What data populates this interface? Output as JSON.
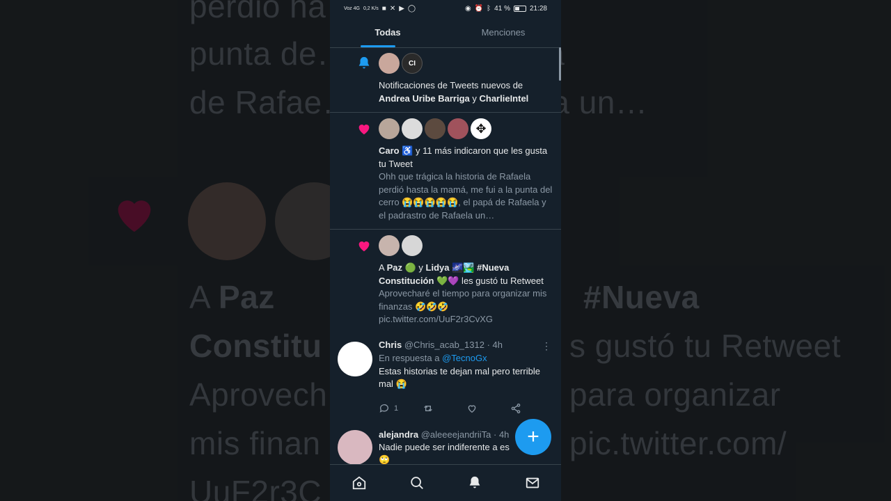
{
  "background": {
    "lines": [
      "perdió ha…                                me fui a la",
      "punta de…               😭😭, el papá",
      "de Rafae…               tro de Rafaela un…"
    ],
    "line_a": "A",
    "line_paz": "Paz",
    "line_nueva": "#Nueva",
    "line_constitu": "Constitu",
    "line_gusto": "s gustó tu Retweet",
    "line_aprovech": "Aprovech",
    "line_para": "para organizar",
    "line_mis": "mis finan",
    "line_pic": "pic.twitter.com/",
    "line_uuf": "UuF2r3C"
  },
  "status_bar": {
    "carrier": "Voz 4G",
    "speed": "0,2 K/s",
    "battery": "41 %",
    "time": "21:28"
  },
  "tabs": [
    {
      "label": "Todas",
      "active": true
    },
    {
      "label": "Menciones",
      "active": false
    }
  ],
  "notifications": [
    {
      "type": "bell",
      "text_pre": "Notificaciones de Tweets nuevos de",
      "bold_1": "Andrea Uribe Barriga",
      "mid": " y ",
      "bold_2": "CharlieIntel",
      "avatar_colors": [
        "#c9a79c",
        "#2a2a2a"
      ]
    },
    {
      "type": "like",
      "bold_1": "Caro",
      "emoji_1": "♿",
      "rest": " y 11 más indicaron que les gusta tu Tweet",
      "sub": "Ohh que trágica la historia de Rafaela perdió hasta la mamá, me fui a la punta del cerro 😭😭😭😭😭, el papá de Rafaela y el padrastro de Rafaela un…",
      "avatar_colors": [
        "#b8a69a",
        "#dcdcdc",
        "#5c4a3f",
        "#a0525c",
        "#ffffff"
      ]
    },
    {
      "type": "like",
      "text_a": "A ",
      "bold_1": "Paz",
      "emoji_1": "🟢",
      "mid": " y ",
      "bold_2": "Lidya",
      "emoji_2": "🌌🏞️",
      "bold_3": "#Nueva Constitución",
      "emoji_3": "💚💜",
      "rest": " les gustó tu Retweet",
      "sub": "Aprovecharé el tiempo para organizar mis finanzas 🤣🤣🤣 pic.twitter.com/UuF2r3CvXG",
      "avatar_colors": [
        "#c7b4ad",
        "#d7d7d7"
      ]
    }
  ],
  "tweets": [
    {
      "name": "Chris",
      "handle": "@Chris_acab_1312",
      "time": "· 4h",
      "reply_prefix": "En respuesta a",
      "reply_to": "@TecnoGx",
      "body": "Estas historias te dejan mal pero terrible mal 😭",
      "reply_count": "1",
      "avatar_color": "#ffffff"
    },
    {
      "name": "alejandra",
      "handle": "@aleeeejandriiTa",
      "time": "· 4h",
      "body": "Nadie puede ser indiferente a es",
      "body2": "🙄",
      "avatar_color": "#d9b8c0"
    }
  ],
  "fab_label": "+",
  "icons": {
    "home": "home-icon",
    "search": "search-icon",
    "notifications": "bell-icon",
    "messages": "mail-icon"
  },
  "colors": {
    "accent": "#1d9bf0",
    "like": "#f91880",
    "background": "#15202b",
    "text_secondary": "#8b98a5"
  }
}
